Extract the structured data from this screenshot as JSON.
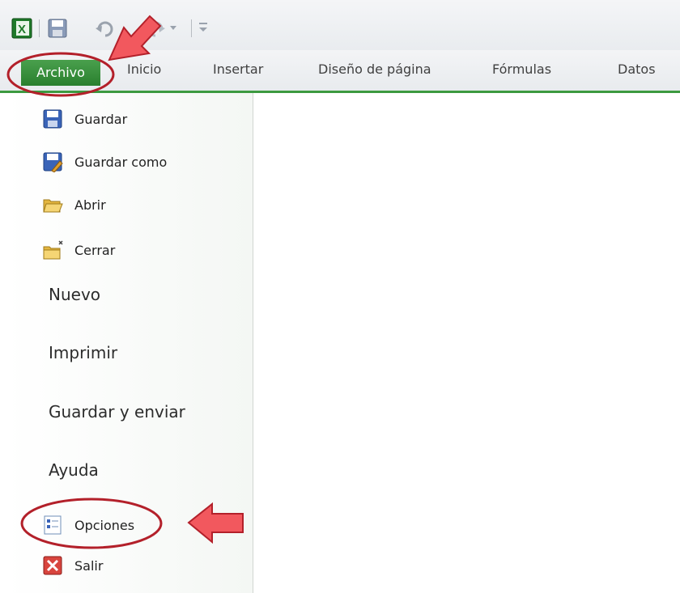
{
  "qat": {
    "items": [
      "excel-logo-icon",
      "save-icon",
      "undo-icon",
      "redo-icon",
      "customize-qat-icon"
    ]
  },
  "ribbon": {
    "file_tab": "Archivo",
    "tabs": [
      "Inicio",
      "Insertar",
      "Diseño de página",
      "Fórmulas",
      "Datos"
    ]
  },
  "backstage": {
    "commands_top": [
      {
        "label": "Guardar",
        "icon": "save-icon"
      },
      {
        "label": "Guardar como",
        "icon": "save-as-icon"
      },
      {
        "label": "Abrir",
        "icon": "open-folder-icon"
      },
      {
        "label": "Cerrar",
        "icon": "close-folder-icon"
      }
    ],
    "sections": [
      "Nuevo",
      "Imprimir",
      "Guardar y enviar",
      "Ayuda"
    ],
    "commands_bottom": [
      {
        "label": "Opciones",
        "icon": "options-icon"
      },
      {
        "label": "Salir",
        "icon": "exit-icon"
      }
    ]
  },
  "colors": {
    "file_tab": "#2e8b33",
    "ribbon_accent": "#3c9a40",
    "annotation_ellipse": "#b3202a",
    "annotation_arrow": "#e8454b"
  }
}
